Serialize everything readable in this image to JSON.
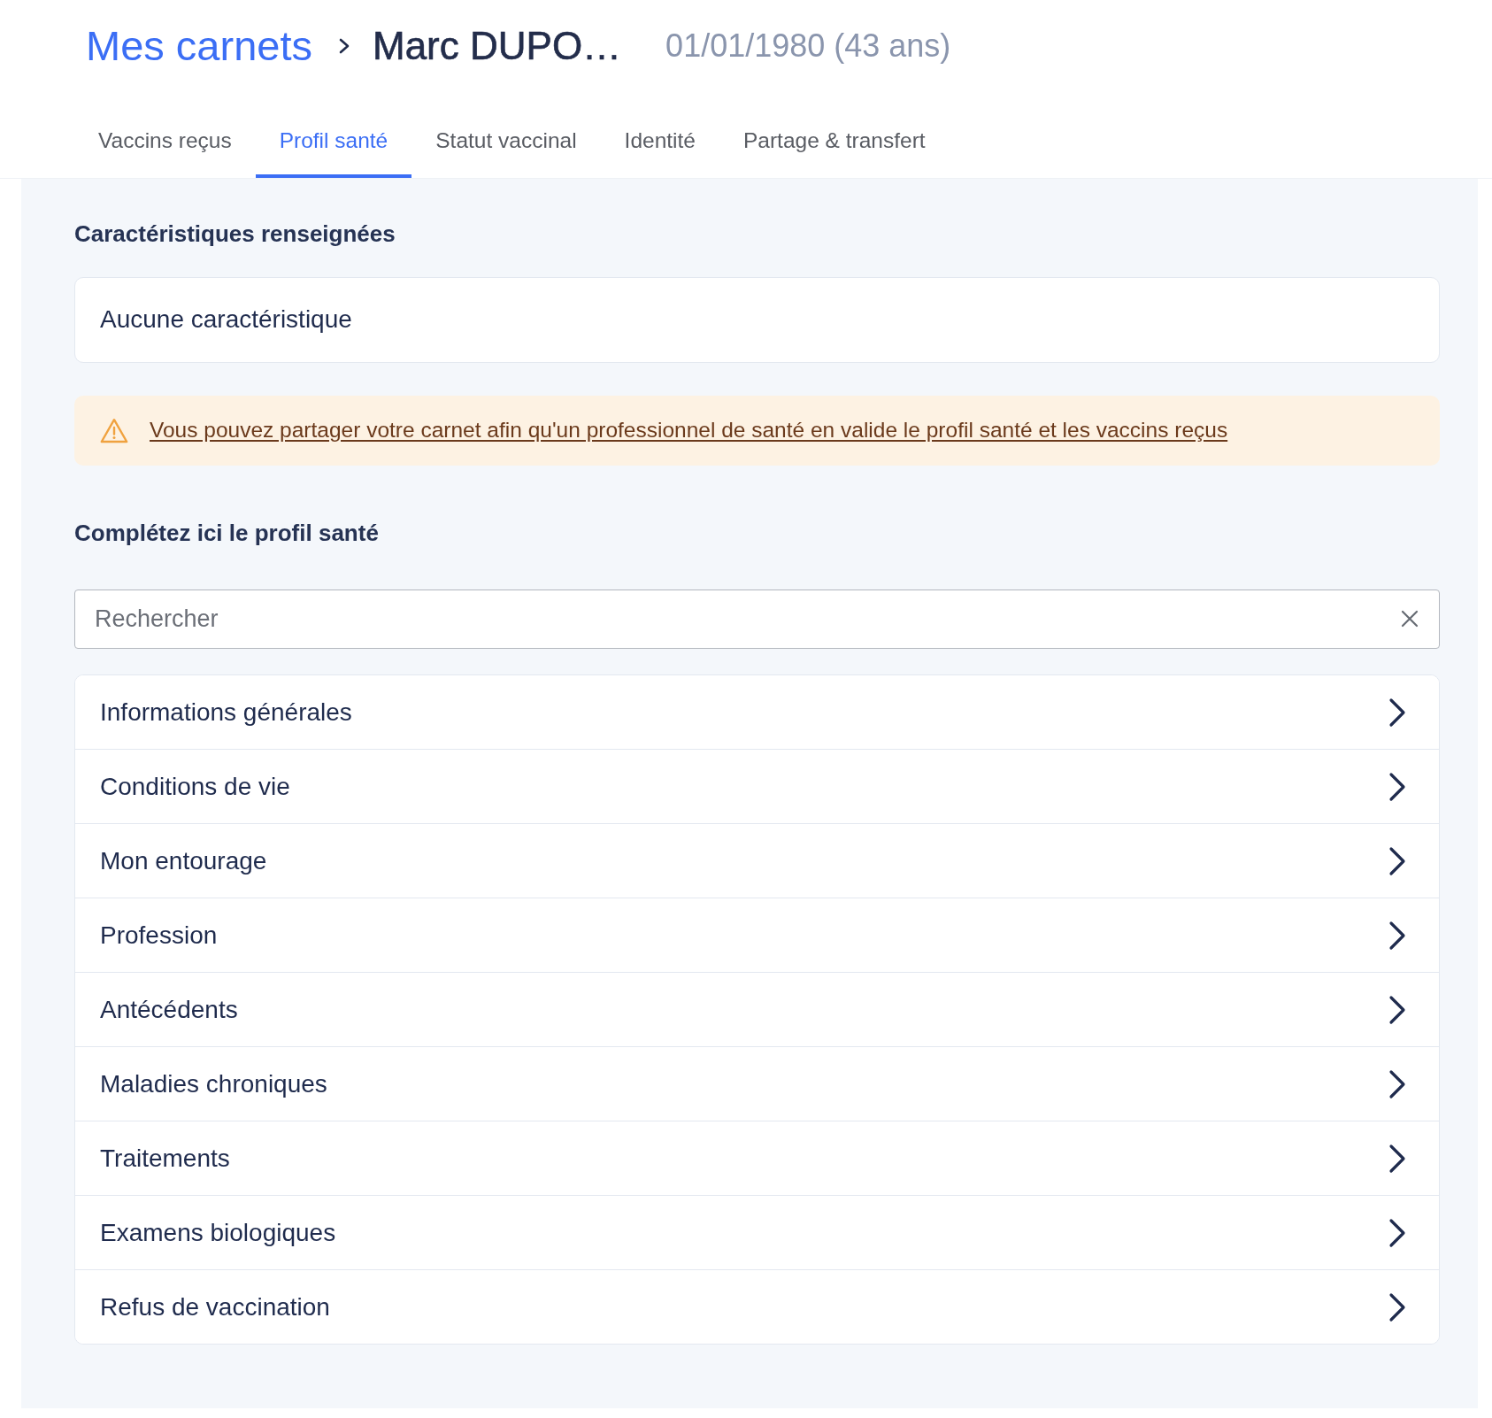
{
  "breadcrumb": {
    "root": "Mes carnets",
    "current": "Marc DUPO…",
    "birth_date": "01/01/1980 (43 ans)"
  },
  "tabs": [
    {
      "label": "Vaccins reçus",
      "selected": false
    },
    {
      "label": "Profil santé",
      "selected": true
    },
    {
      "label": "Statut vaccinal",
      "selected": false
    },
    {
      "label": "Identité",
      "selected": false
    },
    {
      "label": "Partage & transfert",
      "selected": false
    }
  ],
  "characteristics": {
    "title": "Caractéristiques renseignées",
    "empty_text": "Aucune caractéristique"
  },
  "notice": {
    "link": "Vous pouvez partager votre carnet afin qu'un professionnel de santé en valide le profil santé et les vaccins reçus"
  },
  "profile": {
    "title": "Complétez ici le profil santé",
    "search": {
      "placeholder": "Rechercher"
    },
    "categories": [
      "Informations générales",
      "Conditions de vie",
      "Mon entourage",
      "Profession",
      "Antécédents",
      "Maladies chroniques",
      "Traitements",
      "Examens biologiques",
      "Refus de vaccination"
    ]
  }
}
